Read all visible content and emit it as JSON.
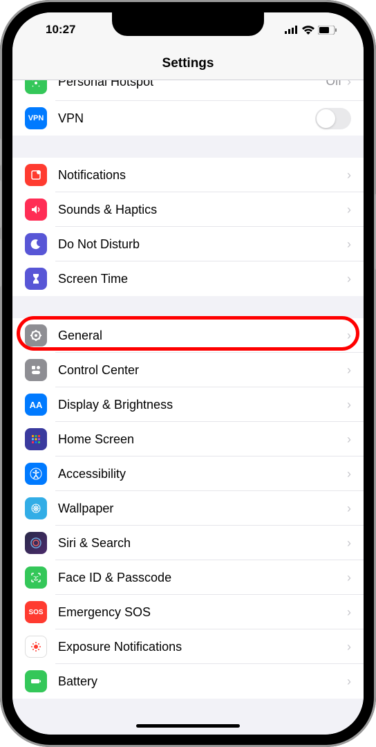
{
  "status": {
    "time": "10:27"
  },
  "header": {
    "title": "Settings"
  },
  "sections": {
    "top": {
      "hotspot": {
        "label": "Personal Hotspot",
        "value": "Off"
      },
      "vpn": {
        "label": "VPN",
        "badge": "VPN"
      }
    },
    "notif": {
      "notifications": {
        "label": "Notifications"
      },
      "sounds": {
        "label": "Sounds & Haptics"
      },
      "dnd": {
        "label": "Do Not Disturb"
      },
      "screentime": {
        "label": "Screen Time"
      }
    },
    "general": {
      "general": {
        "label": "General"
      },
      "control": {
        "label": "Control Center"
      },
      "display": {
        "label": "Display & Brightness",
        "icon": "AA"
      },
      "home": {
        "label": "Home Screen"
      },
      "accessibility": {
        "label": "Accessibility"
      },
      "wallpaper": {
        "label": "Wallpaper"
      },
      "siri": {
        "label": "Siri & Search"
      },
      "face": {
        "label": "Face ID & Passcode"
      },
      "sos": {
        "label": "Emergency SOS",
        "icon": "SOS"
      },
      "exposure": {
        "label": "Exposure Notifications"
      },
      "battery": {
        "label": "Battery"
      }
    }
  },
  "colors": {
    "green": "#34c759",
    "blue": "#007aff",
    "red": "#ff3b30",
    "purple": "#5856d6",
    "gray": "#8e8e93",
    "lightblue": "#32ade6",
    "orange": "#ff9500"
  }
}
